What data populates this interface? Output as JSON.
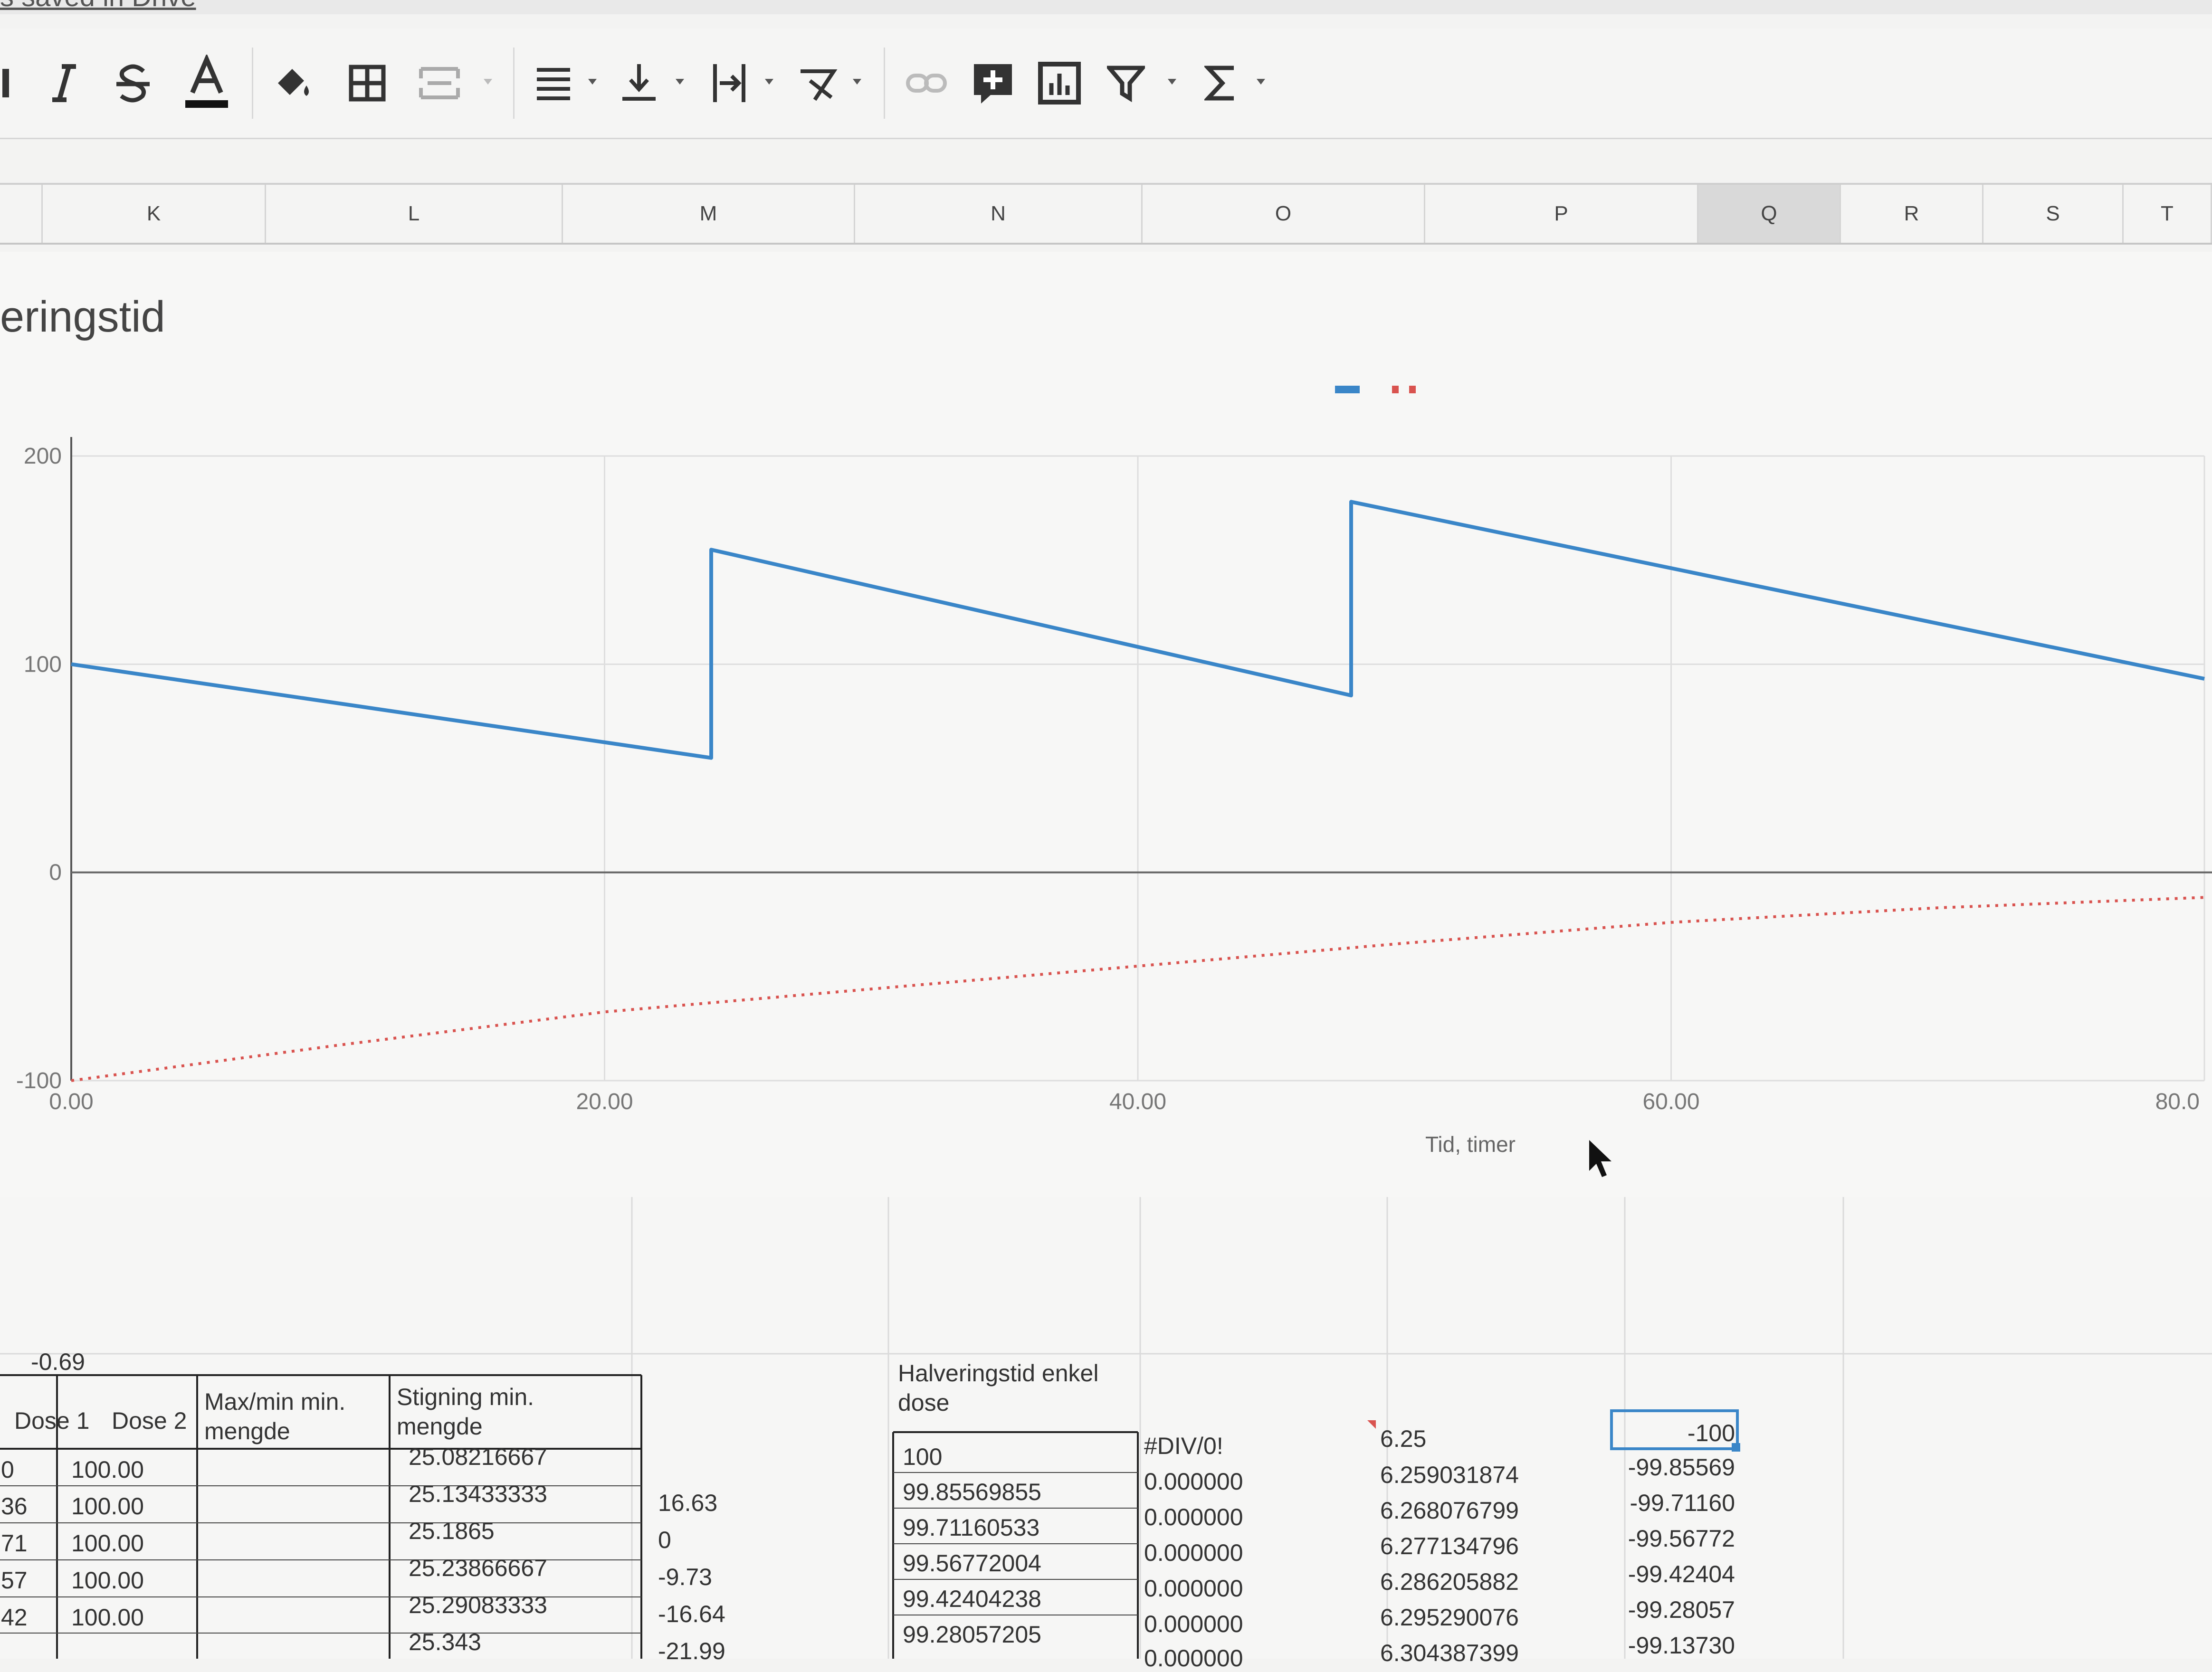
{
  "app": {
    "saved_status": "s saved in Drive"
  },
  "toolbar": {
    "icons": [
      "bold-icon",
      "italic-icon",
      "strikethrough-icon",
      "text-color-icon",
      "fill-color-icon",
      "borders-icon",
      "merge-cells-icon",
      "align-horizontal-icon",
      "align-vertical-icon",
      "text-wrap-icon",
      "text-rotate-icon",
      "link-icon",
      "insert-comment-icon",
      "insert-chart-icon",
      "filter-icon",
      "functions-icon"
    ],
    "text_color_underline": "#111111"
  },
  "columns": [
    "K",
    "L",
    "M",
    "N",
    "O",
    "P",
    "Q",
    "R",
    "S",
    "T"
  ],
  "selected_column": "Q",
  "chart": {
    "title": "eringstid",
    "colors": {
      "series1": "#3a86c8",
      "series2": "#d9534f",
      "grid": "#dedede",
      "axis": "#555555"
    },
    "chart_data": {
      "type": "line",
      "title": "eringstid",
      "xlabel": "Tid, timer",
      "ylabel": "",
      "xlim": [
        0,
        80
      ],
      "ylim": [
        -100,
        200
      ],
      "y_ticks": [
        "200",
        "100",
        "0",
        "-100"
      ],
      "x_ticks": [
        "0.00",
        "20.00",
        "40.00",
        "60.00",
        "80.0"
      ],
      "legend": "top-center",
      "grid": true,
      "series": [
        {
          "style": "solid",
          "x": [
            0,
            24,
            24,
            48,
            48,
            80
          ],
          "y": [
            100,
            55,
            155,
            85,
            178,
            93
          ]
        },
        {
          "style": "dotted",
          "x": [
            0,
            10,
            20,
            30,
            40,
            50,
            60,
            70,
            80
          ],
          "y": [
            -100,
            -83,
            -67,
            -56,
            -45,
            -34,
            -24,
            -17,
            -12
          ]
        }
      ]
    }
  },
  "table": {
    "floating_value": "-0.69",
    "headers": {
      "dose1": "Dose 1",
      "dose2": "Dose 2",
      "maxmin": "Max/min min. mengde",
      "stigning": "Stigning min. mengde",
      "halvering": "Halveringstid enkel dose"
    },
    "row_prefix": [
      "0",
      "36",
      "71",
      "57",
      "42"
    ],
    "dose1": [
      "100.00",
      "100.00",
      "100.00",
      "100.00",
      "100.00"
    ],
    "stigning": [
      "25.08216667",
      "25.13433333",
      "25.1865",
      "25.23866667",
      "25.29083333",
      "25.343"
    ],
    "m_col": [
      "16.63",
      "0",
      "-9.73",
      "-16.64",
      "-21.99"
    ],
    "halvering": [
      "100",
      "99.85569855",
      "99.71160533",
      "99.56772004",
      "99.42404238",
      "99.28057205"
    ],
    "o_col": [
      "#DIV/0!",
      "0.000000",
      "0.000000",
      "0.000000",
      "0.000000",
      "0.000000",
      "0.000000"
    ],
    "p_col": [
      "6.25",
      "6.259031874",
      "6.268076799",
      "6.277134796",
      "6.286205882",
      "6.295290076",
      "6.304387399"
    ],
    "q_col": [
      "-100",
      "-99.85569",
      "-99.71160",
      "-99.56772",
      "-99.42404",
      "-99.28057",
      "-99.13730"
    ]
  }
}
